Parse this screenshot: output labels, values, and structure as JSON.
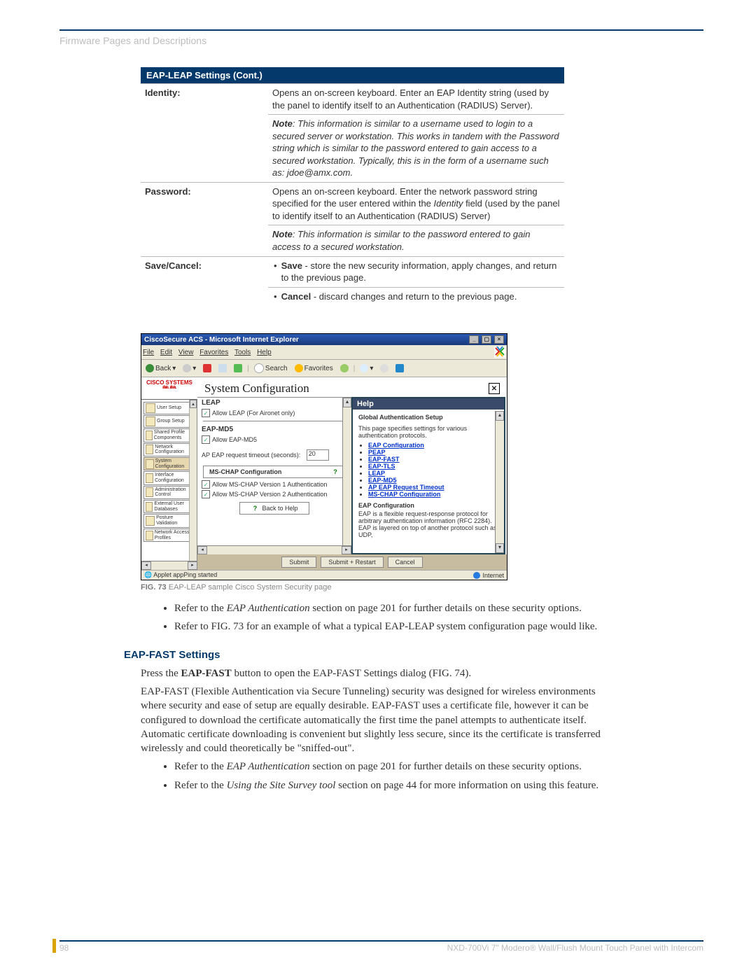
{
  "header": {
    "breadcrumb": "Firmware Pages and Descriptions"
  },
  "table": {
    "title": "EAP-LEAP Settings (Cont.)",
    "rows": [
      {
        "label": "Identity:",
        "desc1": "Opens an on-screen keyboard. Enter an EAP Identity string (used by the panel to identify itself to an Authentication (RADIUS) Server).",
        "note1_label": "Note",
        "note1": ": This information is similar to a username used to login to a secured server or workstation. This works in tandem with the Password string which is similar to the password entered to gain access to a secured workstation. Typically, this is in the form of a username such as: jdoe@amx.com."
      },
      {
        "label": "Password:",
        "desc1_a": "Opens an on-screen keyboard. Enter the network password string specified for the user entered within the ",
        "desc1_b": "Identity",
        "desc1_c": " field (used by the panel to identify itself to an Authentication (RADIUS) Server)",
        "note1_label": "Note",
        "note1": ": This information is similar to the password entered to gain access to a secured workstation."
      },
      {
        "label": "Save/Cancel:",
        "b1_bold": "Save",
        "b1_rest": " - store the new security information, apply changes, and return to the previous page.",
        "b2_bold": "Cancel",
        "b2_rest": " - discard changes and return to the previous page."
      }
    ]
  },
  "shot": {
    "title": "CiscoSecure ACS - Microsoft Internet Explorer",
    "menus": [
      "File",
      "Edit",
      "View",
      "Favorites",
      "Tools",
      "Help"
    ],
    "back": "Back",
    "search": "Search",
    "favorites": "Favorites",
    "cisco": "CISCO SYSTEMS",
    "cisco_bars": "ıllıılı.  ıllıılı.",
    "nav": [
      "User Setup",
      "Group Setup",
      "Shared Profile Components",
      "Network Configuration",
      "System Configuration",
      "Interface Configuration",
      "Administration Control",
      "External User Databases",
      "Posture Validation",
      "Network Access Profiles"
    ],
    "sys_title": "System Configuration",
    "leap": "LEAP",
    "leap_cb": "Allow LEAP (For Aironet only)",
    "eapmd5": "EAP-MD5",
    "eapmd5_cb": "Allow EAP-MD5",
    "timeout_label": "AP EAP request timeout (seconds):",
    "timeout_val": "20",
    "mschap_hdr": "MS-CHAP Configuration",
    "mschap1": "Allow MS-CHAP Version 1 Authentication",
    "mschap2": "Allow MS-CHAP Version 2 Authentication",
    "backhelp": "Back to Help",
    "submit": "Submit",
    "submit_restart": "Submit + Restart",
    "cancel": "Cancel",
    "help_title": "Help",
    "help_lead": "Global Authentication Setup",
    "help_para": "This page specifies settings for various authentication protocols.",
    "help_links": [
      "EAP Configuration",
      "PEAP",
      "EAP-FAST",
      "EAP-TLS",
      "LEAP",
      "EAP-MD5",
      "AP EAP Request Timeout",
      "MS-CHAP Configuration"
    ],
    "help_sub": "EAP Configuration",
    "help_para2": "EAP is a flexible request-response protocol for arbitrary authentication information (RFC 2284). EAP is layered on top of another protocol such as UDP,",
    "status_left": "Applet appPing started",
    "status_right": "Internet"
  },
  "fig_caption_bold": "FIG. 73",
  "fig_caption_rest": "  EAP-LEAP sample Cisco System Security page",
  "bullets1": {
    "b1_a": "Refer to the ",
    "b1_b": "EAP Authentication",
    "b1_c": " section on page 201 for further details on these security options.",
    "b2": "Refer to FIG. 73 for an example of what a typical EAP-LEAP system configuration page would like."
  },
  "h3": "EAP-FAST Settings",
  "p1_a": "Press the ",
  "p1_b": "EAP-FAST",
  "p1_c": " button to open the EAP-FAST Settings dialog (FIG. 74).",
  "p2": "EAP-FAST (Flexible Authentication via Secure Tunneling) security was designed for wireless environments where security and ease of setup are equally desirable. EAP-FAST uses a certificate file, however it can be configured to download the certificate automatically the first time the panel attempts to authenticate itself. Automatic certificate downloading is convenient but slightly less secure, since its the certificate is transferred wirelessly and could theoretically be \"sniffed-out\".",
  "bullets2": {
    "b1_a": "Refer to the ",
    "b1_b": "EAP Authentication",
    "b1_c": " section on page 201 for further details on these security options.",
    "b2_a": "Refer to the ",
    "b2_b": "Using the Site Survey tool",
    "b2_c": " section on page 44 for more information on using this feature."
  },
  "footer": {
    "page": "98",
    "product": "NXD-700Vi 7\" Modero® Wall/Flush Mount Touch Panel with Intercom"
  }
}
